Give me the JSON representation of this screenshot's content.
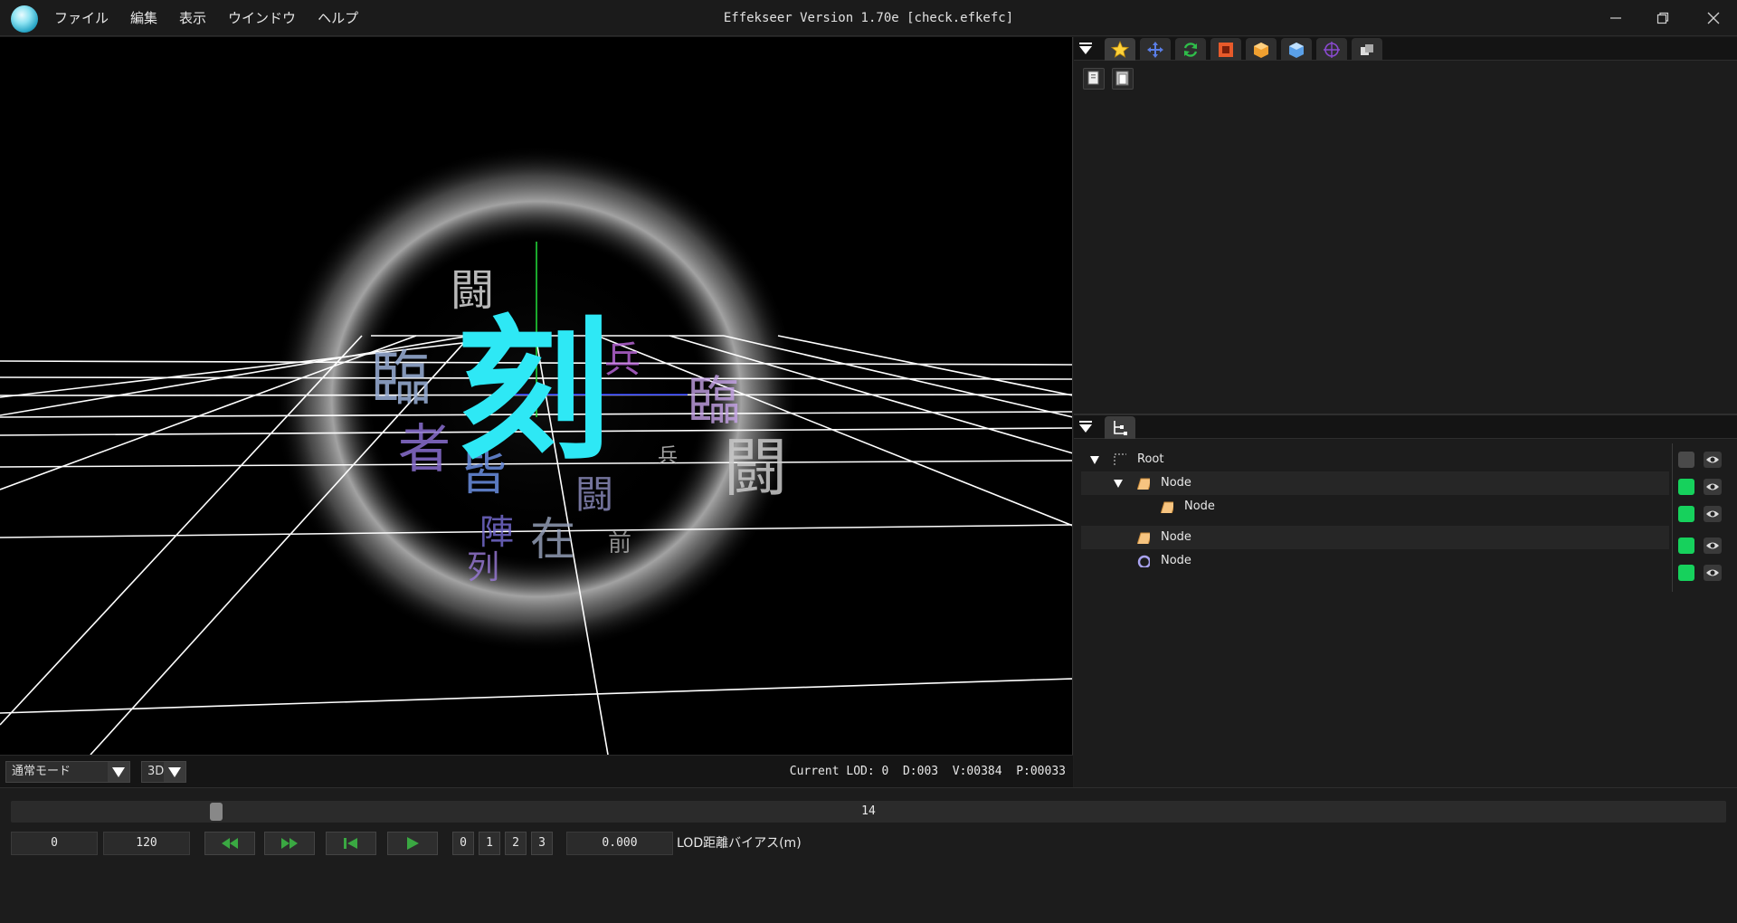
{
  "window": {
    "title": "Effekseer Version 1.70e [check.efkefc]",
    "minimize_icon": "minimize-icon",
    "restore_icon": "restore-icon",
    "close_icon": "close-icon"
  },
  "menu": {
    "items": [
      "ファイル",
      "編集",
      "表示",
      "ウインドウ",
      "ヘルプ"
    ]
  },
  "viewport": {
    "effect_kanji_center": "刻",
    "effect_kanji": [
      "闘",
      "臨",
      "兵",
      "臨",
      "闘",
      "者",
      "皆",
      "陣",
      "在",
      "前",
      "列",
      "闘",
      "兵"
    ],
    "accent_cyan": "#2ee8f5",
    "grid_color": "#ffffff"
  },
  "view_status": {
    "mode_select": "通常モード",
    "dimension_select": "3D",
    "lod_info": "Current LOD: 0  D:003  V:00384  P:00033"
  },
  "toolbar": {
    "tabs": [
      "star-icon",
      "move-icon",
      "refresh-icon",
      "box-frame-icon",
      "package-icon",
      "cube-icon",
      "target-icon",
      "layers-icon"
    ],
    "copy_icon": "copy-icon",
    "paste_icon": "paste-icon"
  },
  "node_tree": {
    "tab_icon": "node-tree-icon",
    "nodes": [
      {
        "label": "Root",
        "icon": "root-dashed-icon",
        "expanded": true,
        "visible": false
      },
      {
        "label": "Node",
        "icon": "sprite-node-icon",
        "expanded": true,
        "visible": true
      },
      {
        "label": "Node",
        "icon": "sprite-node-icon",
        "expanded": false,
        "visible": true
      },
      {
        "label": "Node",
        "icon": "sprite-node-icon",
        "expanded": false,
        "visible": true
      },
      {
        "label": "Node",
        "icon": "ring-node-icon",
        "expanded": false,
        "visible": true
      }
    ],
    "visible_color": "#16d15c",
    "hidden_color": "#4a4a4a"
  },
  "timeline": {
    "current_frame": "14",
    "current_frame_value": 14,
    "start_frame": "0",
    "end_frame": "120",
    "lod_numbers": [
      "0",
      "1",
      "2",
      "3"
    ],
    "lod_bias_value": "0.000",
    "lod_bias_label": "LOD距離バイアス(m)",
    "buttons": [
      "rewind-icon",
      "fast-forward-icon",
      "skip-start-icon",
      "play-icon"
    ],
    "button_color": "#3aa842"
  }
}
